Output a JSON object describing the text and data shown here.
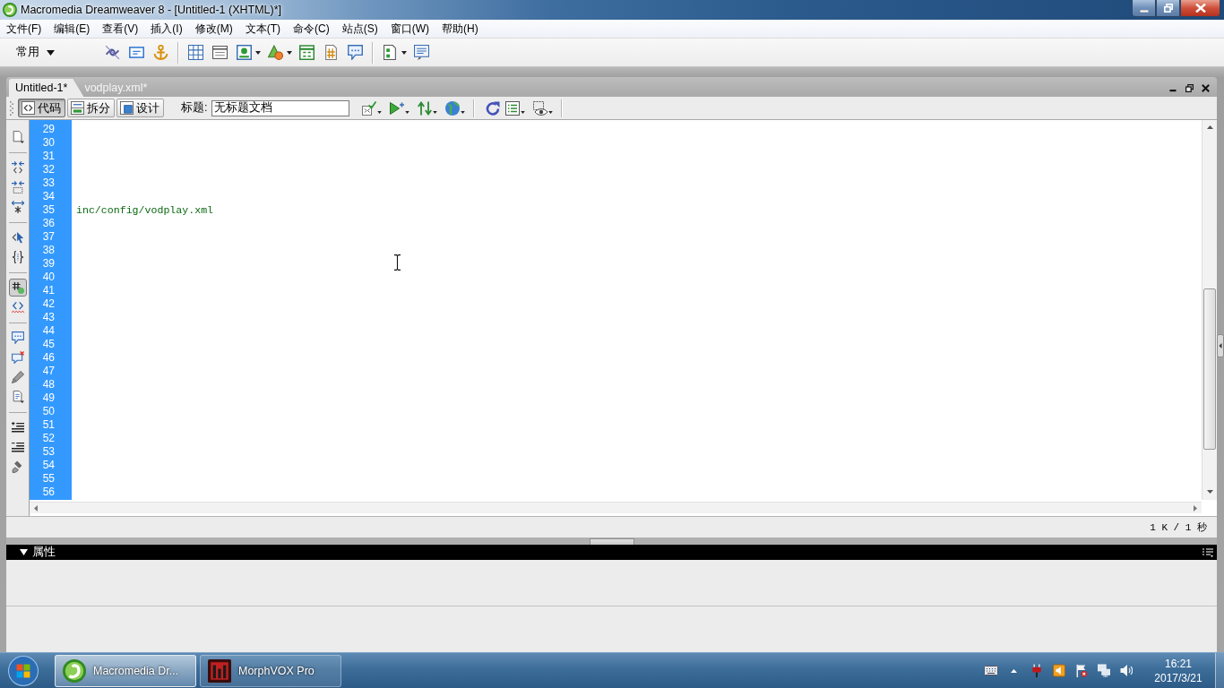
{
  "window": {
    "title": "Macromedia Dreamweaver 8 - [Untitled-1 (XHTML)*]"
  },
  "menu_bar": [
    "文件(F)",
    "编辑(E)",
    "查看(V)",
    "插入(I)",
    "修改(M)",
    "文本(T)",
    "命令(C)",
    "站点(S)",
    "窗口(W)",
    "帮助(H)"
  ],
  "insert_bar": {
    "category": "常用"
  },
  "document_tabs": [
    {
      "label": "Untitled-1*",
      "selected": true
    },
    {
      "label": "vodplay.xml*",
      "selected": false
    }
  ],
  "document_toolbar": {
    "views": [
      {
        "label": "代码",
        "selected": true
      },
      {
        "label": "拆分",
        "selected": false
      },
      {
        "label": "设计",
        "selected": false
      }
    ],
    "title_label": "标题:",
    "title_value": "无标题文档"
  },
  "coding_toolbar": [
    [
      {
        "on": false
      }
    ],
    [
      {
        "on": false
      },
      {
        "on": false
      },
      {
        "on": false
      }
    ],
    [
      {
        "on": false
      },
      {
        "on": false
      }
    ],
    [
      {
        "on": true
      },
      {
        "on": false
      }
    ],
    [
      {
        "on": false
      },
      {
        "on": false
      },
      {
        "on": false
      },
      {
        "on": false
      }
    ],
    [
      {
        "on": false
      },
      {
        "on": false
      },
      {
        "on": false
      }
    ]
  ],
  "code_view": {
    "lines": [
      {
        "number": "29"
      },
      {
        "number": "30"
      },
      {
        "number": "31"
      },
      {
        "number": "32"
      },
      {
        "number": "33"
      },
      {
        "number": "34"
      },
      {
        "number": "35",
        "text": "inc/config/vodplay.xml"
      },
      {
        "number": "36"
      },
      {
        "number": "37"
      },
      {
        "number": "38"
      },
      {
        "number": "39"
      },
      {
        "number": "40"
      },
      {
        "number": "41"
      },
      {
        "number": "42"
      },
      {
        "number": "43"
      },
      {
        "number": "44"
      },
      {
        "number": "45"
      },
      {
        "number": "46"
      },
      {
        "number": "47"
      },
      {
        "number": "48"
      },
      {
        "number": "49"
      },
      {
        "number": "50"
      },
      {
        "number": "51"
      },
      {
        "number": "52"
      },
      {
        "number": "53"
      },
      {
        "number": "54"
      },
      {
        "number": "55"
      },
      {
        "number": "56"
      }
    ]
  },
  "status_bar": {
    "size": "1 K / 1 秒"
  },
  "properties_panel": {
    "title": "属性",
    "expanded": true
  },
  "taskbar": {
    "items": [
      {
        "label": "Macromedia Dr...",
        "selected": true
      },
      {
        "label": "MorphVOX Pro",
        "selected": false
      }
    ],
    "clock_time": "16:21",
    "clock_date": "2017/3/21"
  }
}
